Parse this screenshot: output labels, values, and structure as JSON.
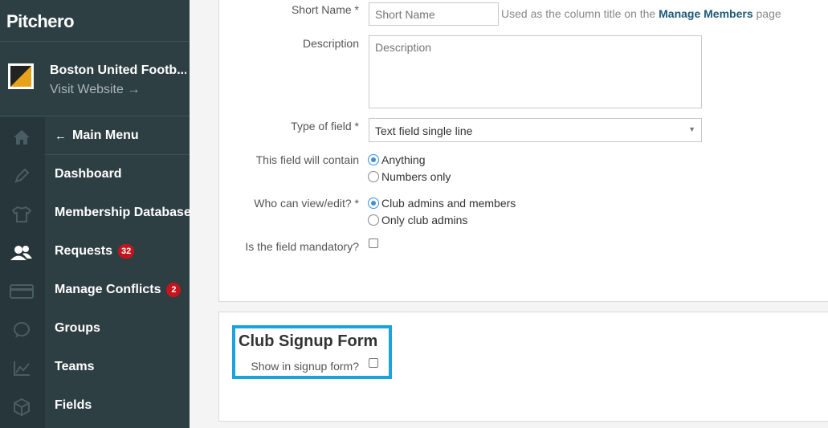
{
  "brand": {
    "logo": "Pitchero"
  },
  "club": {
    "name": "Boston United Footb...",
    "visit": "Visit Website →"
  },
  "menu": {
    "back": "Main Menu",
    "items": [
      {
        "label": "Dashboard"
      },
      {
        "label": "Membership Database"
      },
      {
        "label": "Requests",
        "badge": "32"
      },
      {
        "label": "Manage Conflicts",
        "badge": "2"
      },
      {
        "label": "Groups"
      },
      {
        "label": "Teams"
      },
      {
        "label": "Fields"
      }
    ]
  },
  "rail_icons": [
    "home-icon",
    "pencil-icon",
    "shirt-icon",
    "members-icon",
    "payments-icon",
    "chat-icon",
    "stats-icon",
    "box-icon"
  ],
  "form": {
    "short_name_label": "Short Name *",
    "short_name_placeholder": "Short Name",
    "short_name_help_prefix": "Used as the column title on the",
    "short_name_help_link": "Manage Members",
    "short_name_help_suffix": "page",
    "description_label": "Description",
    "description_placeholder": "Description",
    "type_label": "Type of field *",
    "type_value": "Text field single line",
    "contain_label": "This field will contain",
    "contain_options": [
      "Anything",
      "Numbers only"
    ],
    "contain_selected": "Anything",
    "view_label": "Who can view/edit? *",
    "view_options": [
      "Club admins and members",
      "Only club admins"
    ],
    "view_selected": "Club admins and members",
    "mandatory_label": "Is the field mandatory?",
    "mandatory_checked": false
  },
  "signup": {
    "title": "Club Signup Form",
    "show_label": "Show in signup form?",
    "show_checked": false
  },
  "colors": {
    "sidebar": "#2e3f44",
    "accent": "#1aa3e0",
    "badge": "#c6141c",
    "link": "#1c5a78"
  }
}
